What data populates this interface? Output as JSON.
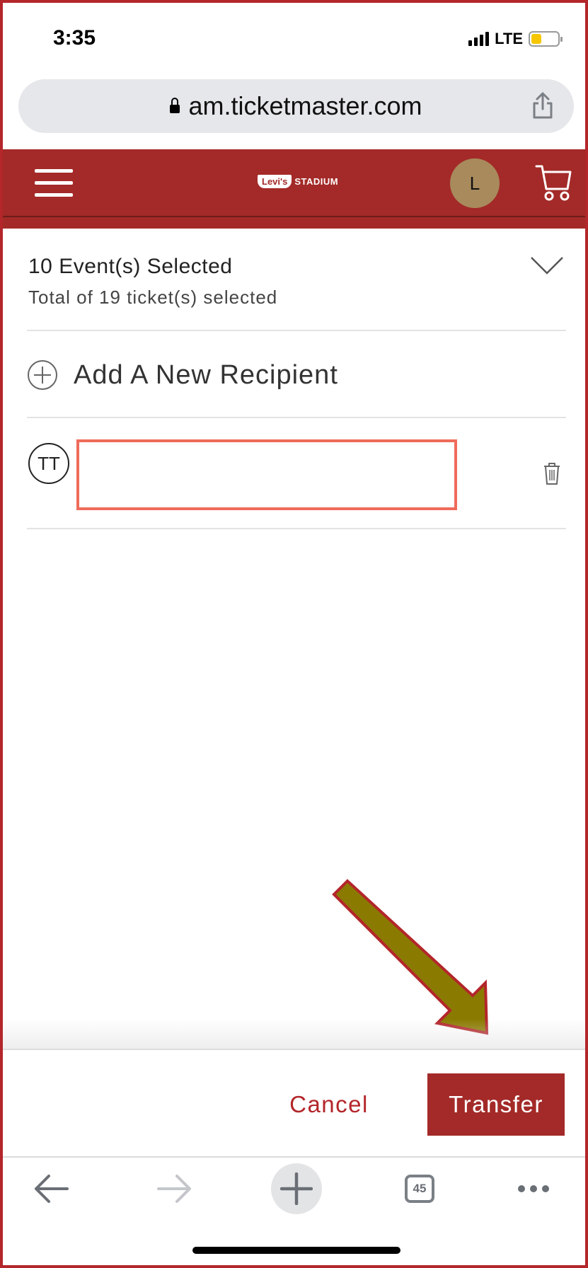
{
  "status_bar": {
    "time": "3:35",
    "network": "LTE",
    "battery_icon": "battery-low-icon"
  },
  "browser": {
    "url": "am.ticketmaster.com",
    "share_icon": "share-icon",
    "tabs_count": "45"
  },
  "header": {
    "menu_icon": "hamburger-menu-icon",
    "logo_brand": "Levi's",
    "logo_suffix": "STADIUM",
    "avatar_initial": "L",
    "cart_icon": "cart-icon",
    "brand_color": "#a32a28"
  },
  "selection": {
    "events_selected": "10 Event(s) Selected",
    "tickets_selected": "Total of 19 ticket(s) selected"
  },
  "add_recipient": {
    "label": "Add A New Recipient"
  },
  "recipient": {
    "initials": "TT",
    "input_value": "",
    "input_border_color": "#ef6b5a"
  },
  "actions": {
    "cancel_label": "Cancel",
    "transfer_label": "Transfer"
  },
  "annotation": {
    "arrow_color": "#8b7a00",
    "arrow_outline_color": "#b3262a"
  }
}
